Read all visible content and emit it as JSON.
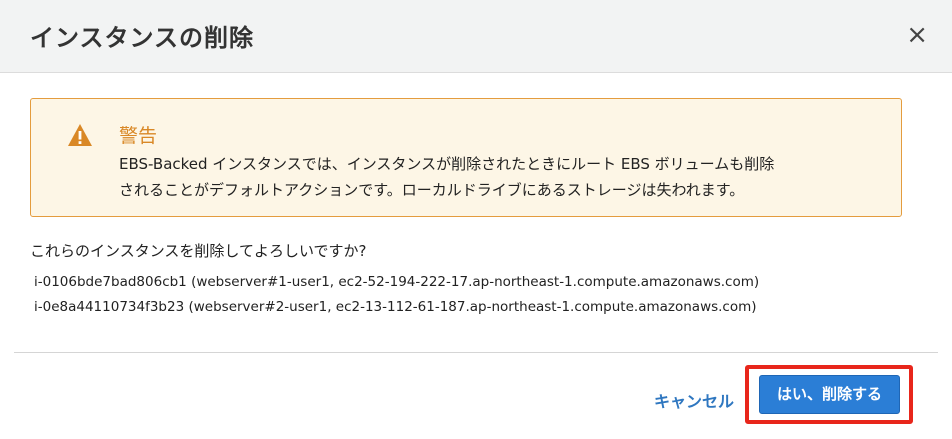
{
  "dialog": {
    "title": "インスタンスの削除",
    "close_icon": "×"
  },
  "warning": {
    "icon": "warning-triangle-icon",
    "title": "警告",
    "line1": "EBS-Backed インスタンスでは、インスタンスが削除されたときにルート EBS ボリュームも削除",
    "line2": "されることがデフォルトアクションです。ローカルドライブにあるストレージは失われます。"
  },
  "confirm": {
    "question": "これらのインスタンスを削除してよろしいですか?",
    "instances": [
      "i-0106bde7bad806cb1 (webserver#1-user1, ec2-52-194-222-17.ap-northeast-1.compute.amazonaws.com)",
      "i-0e8a44110734f3b23 (webserver#2-user1, ec2-13-112-61-187.ap-northeast-1.compute.amazonaws.com)"
    ]
  },
  "footer": {
    "cancel_label": "キャンセル",
    "confirm_label": "はい、削除する"
  },
  "colors": {
    "warning_border": "#e49c3e",
    "warning_bg": "#fdf6e6",
    "primary_button": "#2b7ed6",
    "link": "#2f77c0",
    "highlight_box": "#e8261b"
  }
}
